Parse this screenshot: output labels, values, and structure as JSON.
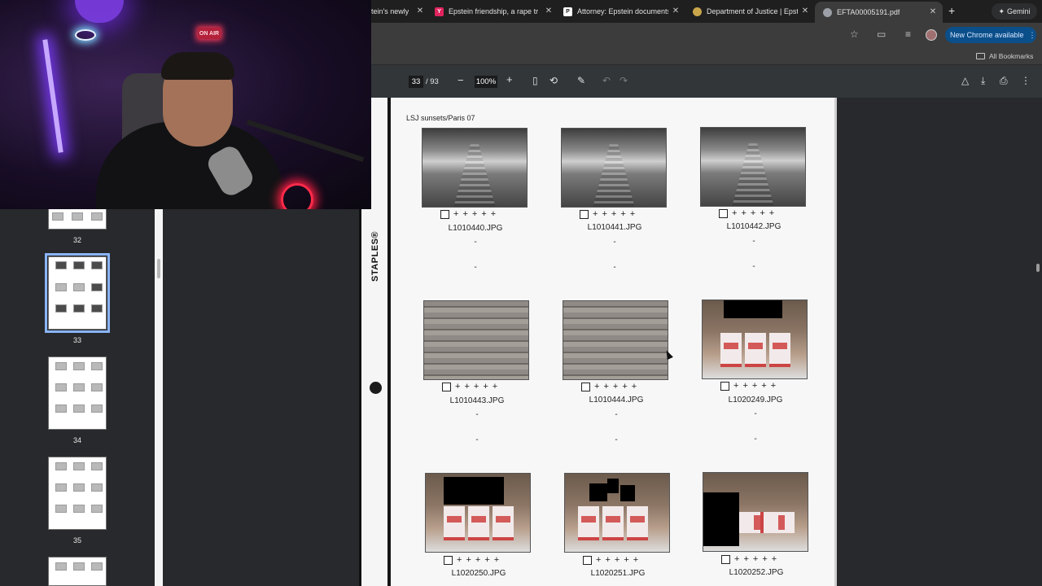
{
  "tabs": [
    {
      "title": "tein's newly",
      "fav_color": "#c0c0c0",
      "fav_char": ""
    },
    {
      "title": "Epstein friendship, a rape tria",
      "fav_color": "#e0245e",
      "fav_char": "Y"
    },
    {
      "title": "Attorney: Epstein documents",
      "fav_color": "#ffffff",
      "fav_char": "P"
    },
    {
      "title": "Department of Justice | Epst",
      "fav_color": "#caa64b",
      "fav_char": ""
    },
    {
      "title": "EFTA00005191.pdf",
      "fav_color": "#9aa0a6",
      "fav_char": ""
    }
  ],
  "toolbar": {
    "new_chrome_label": "New Chrome available",
    "gemini_label": "Gemini",
    "all_bookmarks_label": "All Bookmarks"
  },
  "pdf": {
    "current_page": "33",
    "total_pages": "/ 93",
    "zoom": "100%"
  },
  "thumbnails": [
    {
      "label": "32",
      "selected": false
    },
    {
      "label": "33",
      "selected": true
    },
    {
      "label": "34",
      "selected": false
    },
    {
      "label": "35",
      "selected": false
    }
  ],
  "document": {
    "binder_brand": "STAPLES®",
    "sheet_title": "LSJ sunsets/Paris 07",
    "photos": [
      {
        "filename": "L1010440.JPG",
        "kind": "tunnel"
      },
      {
        "filename": "L1010441.JPG",
        "kind": "tunnel"
      },
      {
        "filename": "L1010442.JPG",
        "kind": "tunnel"
      },
      {
        "filename": "L1010443.JPG",
        "kind": "blind"
      },
      {
        "filename": "L1010444.JPG",
        "kind": "blind"
      },
      {
        "filename": "L1020249.JPG",
        "kind": "room"
      },
      {
        "filename": "L1020250.JPG",
        "kind": "room"
      },
      {
        "filename": "L1020251.JPG",
        "kind": "room"
      },
      {
        "filename": "L1020252.JPG",
        "kind": "room"
      }
    ],
    "dash": "-"
  },
  "webcam": {
    "on_air_label": "ON AIR"
  }
}
